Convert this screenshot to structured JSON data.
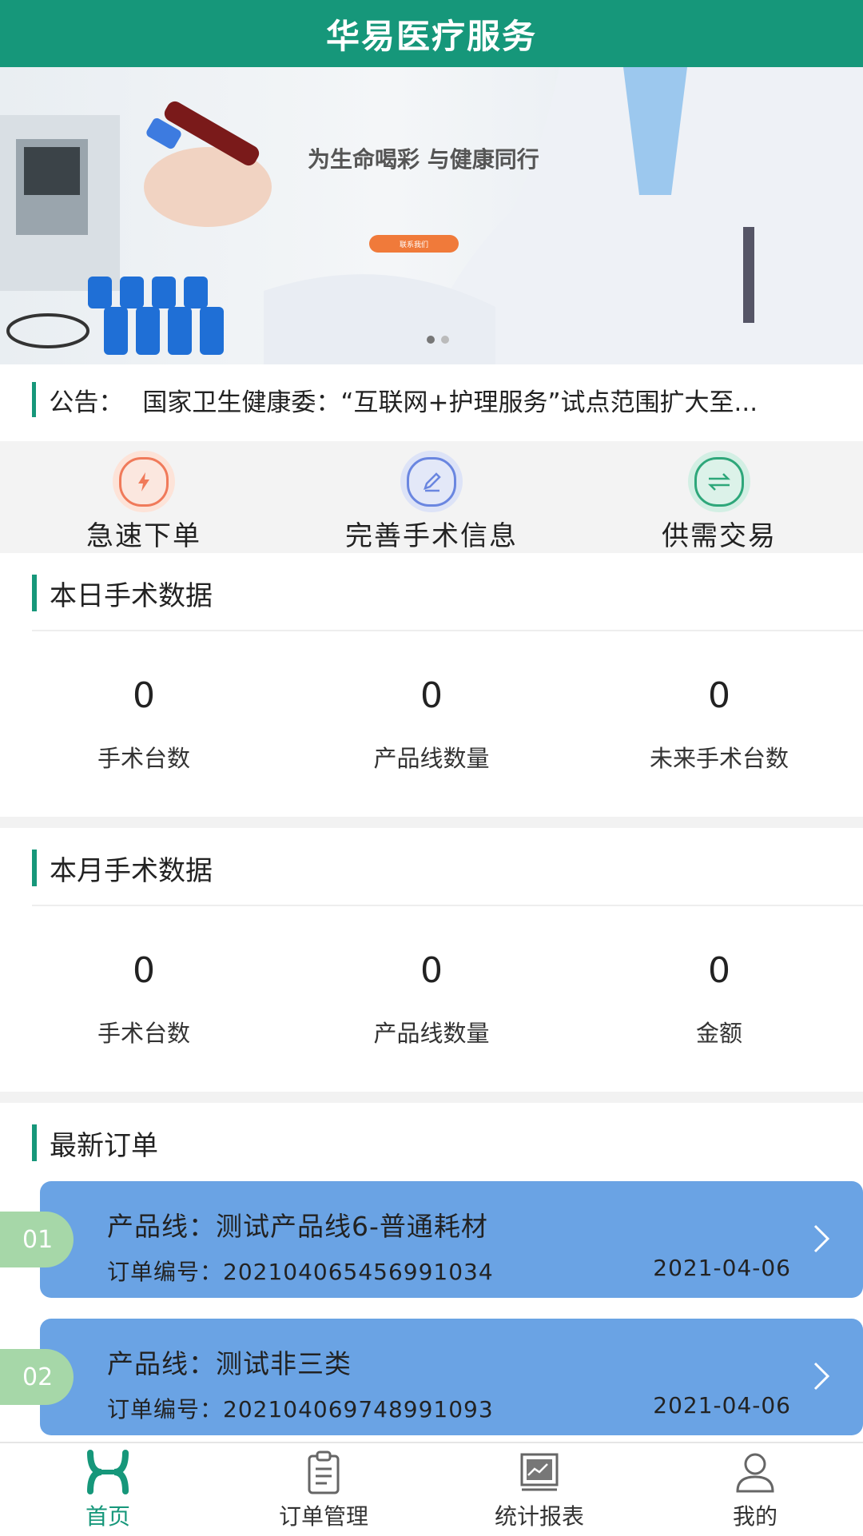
{
  "header": {
    "title": "华易医疗服务"
  },
  "banner": {
    "headline": "为生命喝彩 与健康同行",
    "button": "联系我们",
    "slide_count": 2,
    "active_slide": 1
  },
  "notice": {
    "label": "公告：",
    "text": "国家卫生健康委：“互联网+护理服务”试点范围扩大至..."
  },
  "actions": [
    {
      "label": "急速下单",
      "icon": "lightning-icon",
      "color": "#f07a5a"
    },
    {
      "label": "完善手术信息",
      "icon": "pencil-icon",
      "color": "#6a86e0"
    },
    {
      "label": "供需交易",
      "icon": "exchange-icon",
      "color": "#2ea77a"
    }
  ],
  "today": {
    "title": "本日手术数据",
    "stats": [
      {
        "value": "0",
        "label": "手术台数"
      },
      {
        "value": "0",
        "label": "产品线数量"
      },
      {
        "value": "0",
        "label": "未来手术台数"
      }
    ]
  },
  "month": {
    "title": "本月手术数据",
    "stats": [
      {
        "value": "0",
        "label": "手术台数"
      },
      {
        "value": "0",
        "label": "产品线数量"
      },
      {
        "value": "0",
        "label": "金额"
      }
    ]
  },
  "orders": {
    "title": "最新订单",
    "items": [
      {
        "index": "01",
        "product": "产品线：测试产品线6-普通耗材",
        "order_no": "订单编号：202104065456991034",
        "date": "2021-04-06"
      },
      {
        "index": "02",
        "product": "产品线：测试非三类",
        "order_no": "订单编号：202104069748991093",
        "date": "2021-04-06"
      }
    ]
  },
  "tabs": [
    {
      "label": "首页",
      "icon": "home-icon",
      "active": true
    },
    {
      "label": "订单管理",
      "icon": "clipboard-icon",
      "active": false
    },
    {
      "label": "统计报表",
      "icon": "chart-icon",
      "active": false
    },
    {
      "label": "我的",
      "icon": "user-icon",
      "active": false
    }
  ],
  "colors": {
    "brand": "#16977a",
    "order_card": "#6aa3e4",
    "badge": "#a6d7a8"
  }
}
